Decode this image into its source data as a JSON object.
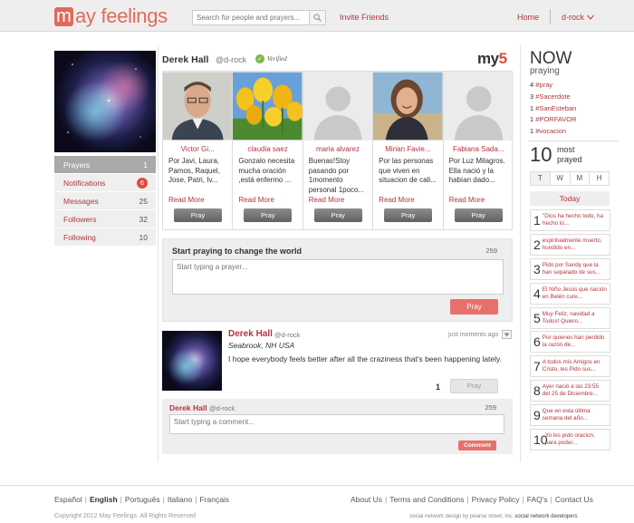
{
  "header": {
    "logo_letter": "m",
    "logo_text": "ay feelings",
    "search_placeholder": "Search for people and prayers...",
    "invite_label": "Invite Friends",
    "home_label": "Home",
    "user_label": "d-rock"
  },
  "sidebar": {
    "items": [
      {
        "label": "Prayers",
        "count": "1"
      },
      {
        "label": "Notifications",
        "count": "6"
      },
      {
        "label": "Messages",
        "count": "25"
      },
      {
        "label": "Followers",
        "count": "32"
      },
      {
        "label": "Following",
        "count": "10"
      }
    ]
  },
  "profile": {
    "name": "Derek Hall",
    "handle": "@d-rock",
    "verified": "Verified",
    "my5_prefix": "my",
    "my5_number": "5"
  },
  "my5": [
    {
      "name": "Victor Gi...",
      "text": "Por Javi, Laura, Pamos, Raquel, Jose, Patri, Iv...",
      "read_more": "Read More",
      "button": "Pray"
    },
    {
      "name": "claudia saez",
      "text": "Gonzalo necesita mucha oración ,está enfermo ...",
      "read_more": "Read More",
      "button": "Pray"
    },
    {
      "name": "maria alvarez",
      "text": "Buenas!Stoy pasando por 1momento personal 1poco...",
      "read_more": "Read More",
      "button": "Pray"
    },
    {
      "name": "Mirian Favie...",
      "text": "Por las personas que viven en situacion de cali...",
      "read_more": "Read More",
      "button": "Pray"
    },
    {
      "name": "Fabiana Sada...",
      "text": "Por Luz Milagros. Ella nació y la habían dado...",
      "read_more": "Read More",
      "button": "Pray"
    }
  ],
  "compose": {
    "title": "Start praying to change the world",
    "count": "259",
    "placeholder": "Start typing a prayer...",
    "button": "Pray"
  },
  "post": {
    "name": "Derek Hall",
    "handle": "@d-rock",
    "time": "just moments ago",
    "location": "Seabrook, NH USA",
    "text": "I hope everybody feels better after all the craziness that's been happening lately.",
    "pray_count": "1",
    "pray_button": "Pray"
  },
  "comment": {
    "name": "Derek Hall",
    "handle": "@d-rock",
    "count": "259",
    "placeholder": "Start typing a comment...",
    "button": "Comment"
  },
  "now": {
    "title": "NOW",
    "subtitle": "praying",
    "tags": [
      {
        "count": "4",
        "tag": "#pray"
      },
      {
        "count": "3",
        "tag": "#Sacerdote"
      },
      {
        "count": "1",
        "tag": "#SanEsteban"
      },
      {
        "count": "1",
        "tag": "#PORFAVOR"
      },
      {
        "count": "1",
        "tag": "#vocacion"
      }
    ]
  },
  "top10": {
    "number": "10",
    "label_line1": "most",
    "label_line2": "prayed",
    "tabs": [
      "T",
      "W",
      "M",
      "H"
    ],
    "active_tab": "T",
    "today_label": "Today",
    "items": [
      {
        "rank": "1",
        "text": "\"Dios ha hecho todo, ha hecho lo..."
      },
      {
        "rank": "2",
        "text": "espiritualmente muerto, hundido en..."
      },
      {
        "rank": "3",
        "text": "Pido por Sandy que la han separado de sus..."
      },
      {
        "rank": "4",
        "text": "El Niño Jesús que nación en Belén cure..."
      },
      {
        "rank": "5",
        "text": "Muy Feliz, navidad a Todos! Quiero..."
      },
      {
        "rank": "6",
        "text": "Por quienes han perdido la razón de..."
      },
      {
        "rank": "7",
        "text": "A todos mis Amigos en Cristo, les Pido sus..."
      },
      {
        "rank": "8",
        "text": "Ayer nació a las 23:55 del 25 de Diciembre..."
      },
      {
        "rank": "9",
        "text": "Que en esta última semana del año..."
      },
      {
        "rank": "10",
        "text": "Yo les pido oracion, para poder..."
      }
    ]
  },
  "footer": {
    "languages": [
      "Español",
      "English",
      "Português",
      "Italiano",
      "Français"
    ],
    "current_language": "English",
    "links": [
      "About Us",
      "Terms and Conditions",
      "Privacy Policy",
      "FAQ's",
      "Contact Us"
    ],
    "copyright": "Copyright 2012 May Feelings. All Rights Reserved",
    "credit_pre": "social network design",
    "credit_by": "by pearse street, inc.",
    "credit_post": "social network developers"
  },
  "colors": {
    "brand": "#e26a5b",
    "link": "#b3343f",
    "accent_button": "#e8706a",
    "badge": "#e24a3b",
    "verified": "#7bb84a"
  }
}
